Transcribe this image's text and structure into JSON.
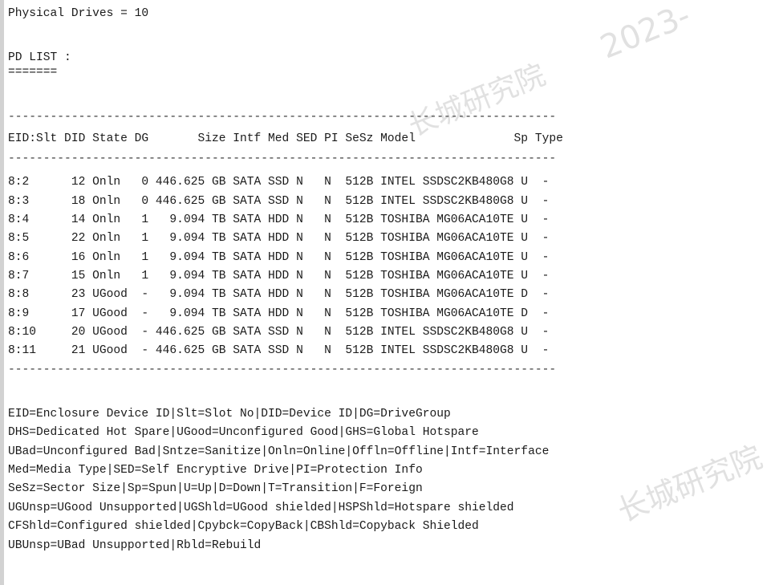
{
  "header": {
    "physical_drives": "Physical Drives = 10",
    "pd_list_title": "PD LIST :",
    "pd_list_underline": "======="
  },
  "table": {
    "rule": "------------------------------------------------------------------------------",
    "header_line": "EID:Slt DID State DG       Size Intf Med SED PI SeSz Model              Sp Type",
    "columns": [
      "EID:Slt",
      "DID",
      "State",
      "DG",
      "Size",
      "Intf",
      "Med",
      "SED",
      "PI",
      "SeSz",
      "Model",
      "Sp",
      "Type"
    ],
    "rows": [
      "8:2      12 Onln   0 446.625 GB SATA SSD N   N  512B INTEL SSDSC2KB480G8 U  -",
      "8:3      18 Onln   0 446.625 GB SATA SSD N   N  512B INTEL SSDSC2KB480G8 U  -",
      "8:4      14 Onln   1   9.094 TB SATA HDD N   N  512B TOSHIBA MG06ACA10TE U  -",
      "8:5      22 Onln   1   9.094 TB SATA HDD N   N  512B TOSHIBA MG06ACA10TE U  -",
      "8:6      16 Onln   1   9.094 TB SATA HDD N   N  512B TOSHIBA MG06ACA10TE U  -",
      "8:7      15 Onln   1   9.094 TB SATA HDD N   N  512B TOSHIBA MG06ACA10TE U  -",
      "8:8      23 UGood  -   9.094 TB SATA HDD N   N  512B TOSHIBA MG06ACA10TE D  -",
      "8:9      17 UGood  -   9.094 TB SATA HDD N   N  512B TOSHIBA MG06ACA10TE D  -",
      "8:10     20 UGood  - 446.625 GB SATA SSD N   N  512B INTEL SSDSC2KB480G8 U  -",
      "8:11     21 UGood  - 446.625 GB SATA SSD N   N  512B INTEL SSDSC2KB480G8 U  -"
    ]
  },
  "legend": [
    "EID=Enclosure Device ID|Slt=Slot No|DID=Device ID|DG=DriveGroup",
    "DHS=Dedicated Hot Spare|UGood=Unconfigured Good|GHS=Global Hotspare",
    "UBad=Unconfigured Bad|Sntze=Sanitize|Onln=Online|Offln=Offline|Intf=Interface",
    "Med=Media Type|SED=Self Encryptive Drive|PI=Protection Info",
    "SeSz=Sector Size|Sp=Spun|U=Up|D=Down|T=Transition|F=Foreign",
    "UGUnsp=UGood Unsupported|UGShld=UGood shielded|HSPShld=Hotspare shielded",
    "CFShld=Configured shielded|Cpybck=CopyBack|CBShld=Copyback Shielded",
    "UBUnsp=UBad Unsupported|Rbld=Rebuild"
  ],
  "watermarks": [
    "2023-",
    "长城研究院",
    "长城研究院"
  ]
}
